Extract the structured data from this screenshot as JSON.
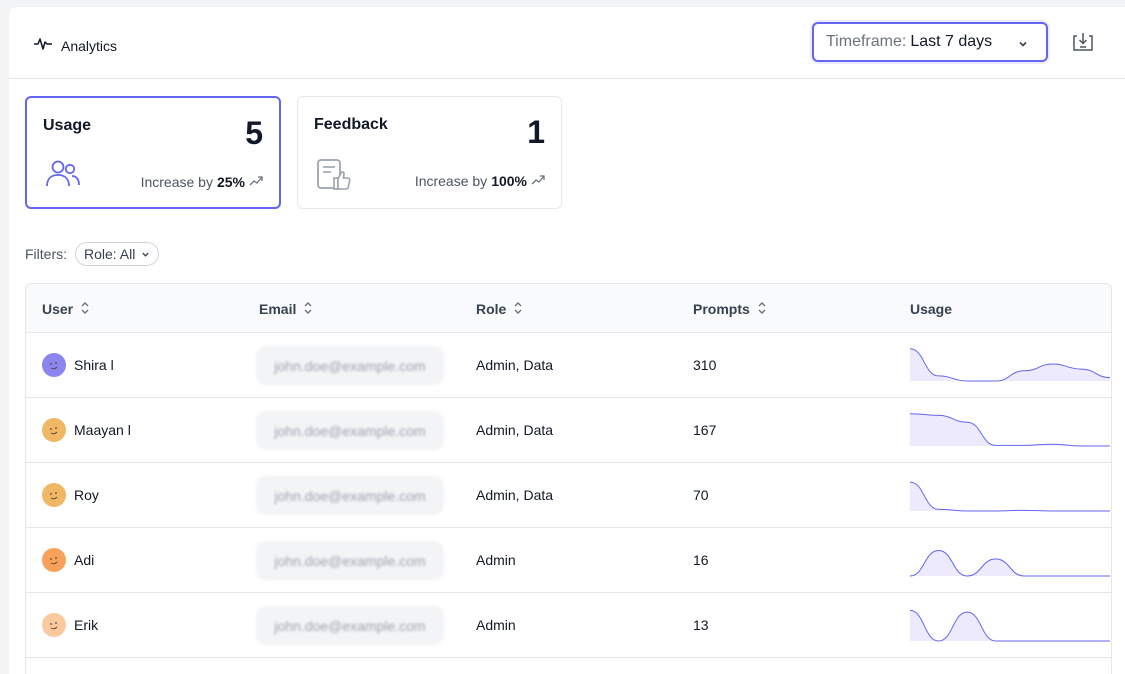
{
  "header": {
    "title": "Analytics",
    "timeframe_label": "Timeframe:",
    "timeframe_value": "Last 7 days"
  },
  "cards": [
    {
      "title": "Usage",
      "count": "5",
      "delta_prefix": "Increase by",
      "delta_value": "25%"
    },
    {
      "title": "Feedback",
      "count": "1",
      "delta_prefix": "Increase by",
      "delta_value": "100%"
    }
  ],
  "filters": {
    "label": "Filters:",
    "role_chip": "Role: All"
  },
  "table": {
    "columns": [
      "User",
      "Email",
      "Role",
      "Prompts",
      "Usage"
    ],
    "rows": [
      {
        "user": "Shira l",
        "email": "john.doe@example.com",
        "role": "Admin, Data",
        "prompts": "310",
        "avatar_color": "#8b85f0",
        "usage": [
          0.95,
          0.15,
          0.0,
          0.0,
          0.3,
          0.5,
          0.35,
          0.1
        ]
      },
      {
        "user": "Maayan l",
        "email": "john.doe@example.com",
        "role": "Admin, Data",
        "prompts": "167",
        "avatar_color": "#f0b865",
        "usage": [
          0.95,
          0.9,
          0.7,
          0.02,
          0.02,
          0.05,
          0.0,
          0.0
        ]
      },
      {
        "user": "Roy",
        "email": "john.doe@example.com",
        "role": "Admin, Data",
        "prompts": "70",
        "avatar_color": "#f0b865",
        "usage": [
          0.85,
          0.05,
          0.0,
          0.0,
          0.02,
          0.0,
          0.0,
          0.0
        ]
      },
      {
        "user": "Adi",
        "email": "john.doe@example.com",
        "role": "Admin",
        "prompts": "16",
        "avatar_color": "#f9a15a",
        "usage": [
          0.0,
          0.75,
          0.0,
          0.5,
          0.0,
          0.0,
          0.0,
          0.0
        ]
      },
      {
        "user": "Erik",
        "email": "john.doe@example.com",
        "role": "Admin",
        "prompts": "13",
        "avatar_color": "#fbc9a0",
        "usage": [
          0.9,
          0.0,
          0.85,
          0.0,
          0.0,
          0.0,
          0.0,
          0.0
        ]
      }
    ]
  },
  "colors": {
    "accent": "#6366f1",
    "spark_fill": "#eceafc",
    "spark_stroke": "#6366f1"
  }
}
